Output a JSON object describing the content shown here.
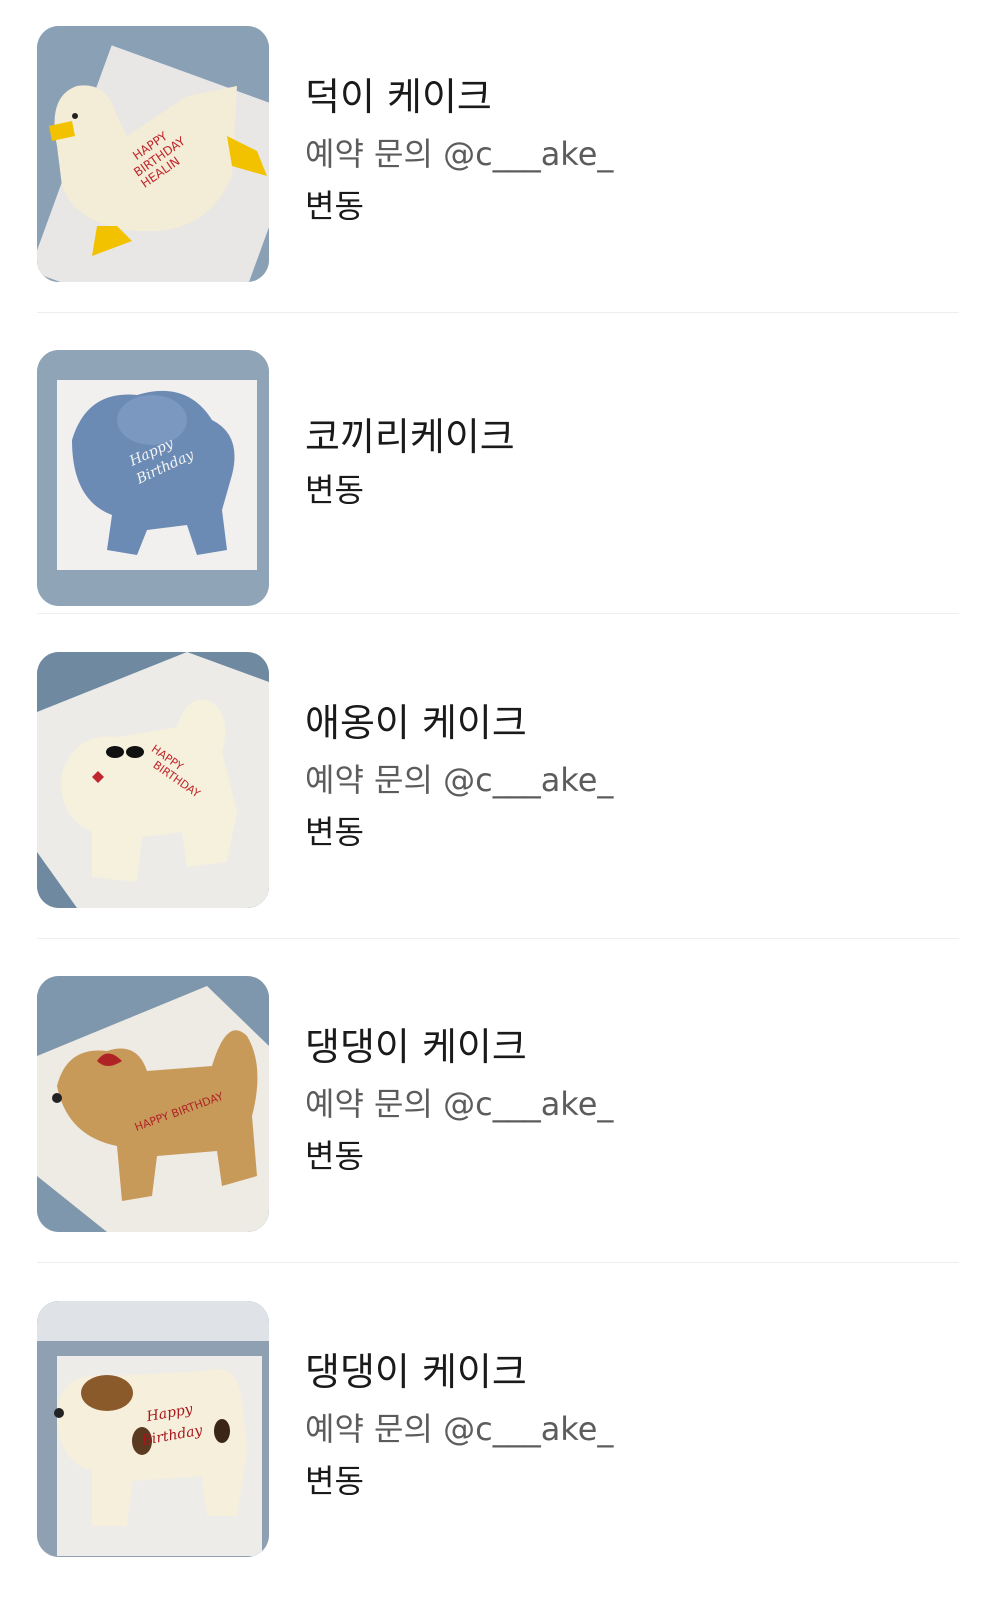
{
  "menu_items": [
    {
      "title": "덕이 케이크",
      "subtitle": "예약 문의 @c___ake_",
      "price": "변동",
      "image": "duck-cake-photo"
    },
    {
      "title": "코끼리케이크",
      "subtitle": "",
      "price": "변동",
      "image": "elephant-cake-photo"
    },
    {
      "title": "애옹이 케이크",
      "subtitle": "예약 문의 @c___ake_",
      "price": "변동",
      "image": "cat-cake-photo"
    },
    {
      "title": "댕댕이 케이크",
      "subtitle": "예약 문의 @c___ake_",
      "price": "변동",
      "image": "puppy-cake-photo"
    },
    {
      "title": "댕댕이 케이크",
      "subtitle": "예약 문의 @c___ake_",
      "price": "변동",
      "image": "spotted-dog-cake-photo"
    }
  ],
  "colors": {
    "title_text": "#1a1a1a",
    "subtitle_text": "#5c5c5c",
    "divider": "#eeeeee",
    "photo_background": "#8ea4b7"
  }
}
